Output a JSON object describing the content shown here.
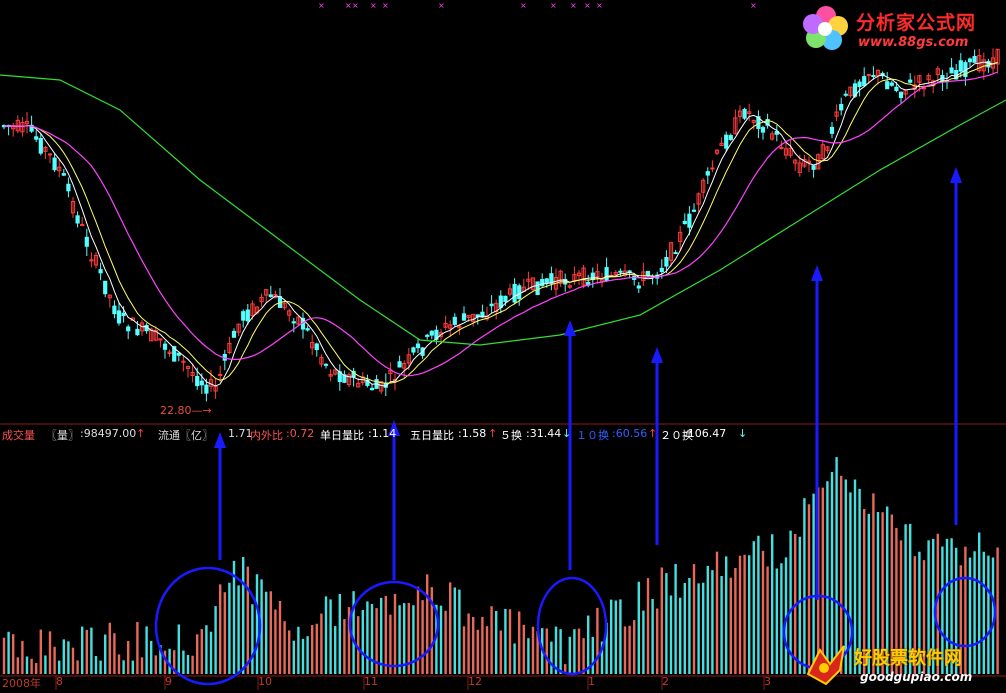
{
  "window": {
    "title": ""
  },
  "info_bar": {
    "vol_label": "成交量",
    "vol_bracket": "〖量〗",
    "vol_value": ":98497.00",
    "float_label": "流通〖亿〗",
    "float_value": "1.71",
    "inout_label": "内外比",
    "inout_value": ":0.72",
    "single_ratio_label": "单日量比",
    "single_ratio_value": ":1.14",
    "five_ratio_label": "五日量比",
    "five_ratio_value": ":1.58",
    "t5_label": "５换",
    "t5_value": ":31.44",
    "t10_label": "１０换",
    "t10_value": ":60.56",
    "t20_label": "２０换",
    "t20_value": ":106.47"
  },
  "low_marker": "22.80",
  "x_axis": {
    "labels": [
      "2008年",
      "8",
      "9",
      "10",
      "11",
      "12",
      "1",
      "2",
      "3"
    ]
  },
  "watermark_top": {
    "name": "分析家公式网",
    "url": "www.88gs.com"
  },
  "watermark_bottom": {
    "name": "好股票软件网",
    "url": "goodgupiao.com"
  },
  "colors": {
    "up": "#ff3c3c",
    "down": "#55ffff",
    "volume_up": "#e8685a",
    "volume_down": "#44e0e0",
    "ma_short": "#ffffff",
    "ma_mid": "#ffff66",
    "ma_long": "#ff44ff",
    "ma_slow": "#33dd33",
    "arrow": "#1a1aff",
    "grid": "#8b1a1a"
  },
  "chart_data": {
    "type": "candlestick",
    "title": "",
    "price_low_annotation": 22.8,
    "volume_value": 98497.0,
    "moving_averages": [
      "ma_short",
      "ma_mid",
      "ma_long",
      "ma_slow"
    ]
  }
}
